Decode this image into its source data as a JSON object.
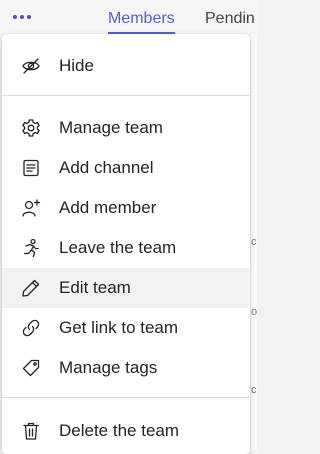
{
  "tabs": {
    "members": "Members",
    "pending": "Pendin"
  },
  "strip_marks": [
    "c",
    "o",
    "c"
  ],
  "menu": {
    "items": [
      {
        "label": "Hide",
        "icon": "eye-slash-icon"
      },
      {
        "label": "Manage team",
        "icon": "gear-icon"
      },
      {
        "label": "Add channel",
        "icon": "channel-list-icon"
      },
      {
        "label": "Add member",
        "icon": "person-add-icon"
      },
      {
        "label": "Leave the team",
        "icon": "leave-run-icon"
      },
      {
        "label": "Edit team",
        "icon": "pencil-icon"
      },
      {
        "label": "Get link to team",
        "icon": "link-icon"
      },
      {
        "label": "Manage tags",
        "icon": "tag-icon"
      },
      {
        "label": "Delete the team",
        "icon": "trash-icon"
      }
    ]
  },
  "colors": {
    "accent": "#5b5fc7",
    "highlight": "#f5f500",
    "hover": "#f3f2f1"
  }
}
